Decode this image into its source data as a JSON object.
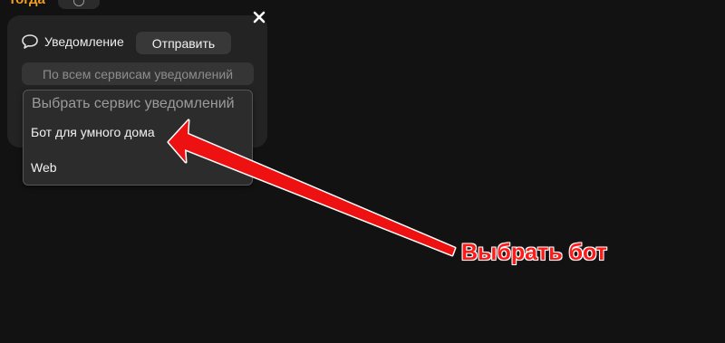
{
  "top": {
    "label": "тогда"
  },
  "panel": {
    "notification_label": "Уведомление",
    "send_label": "Отправить",
    "all_services_label": "По всем сервисам уведомлений"
  },
  "dropdown": {
    "placeholder": "Выбрать сервис уведомлений",
    "options": [
      "Бот для умного дома",
      "Web"
    ]
  },
  "annotation": {
    "text": "Выбрать бот",
    "color": "#ff1a1a"
  },
  "icons": {
    "close": "close-icon",
    "chat": "chat-bubble-icon"
  }
}
